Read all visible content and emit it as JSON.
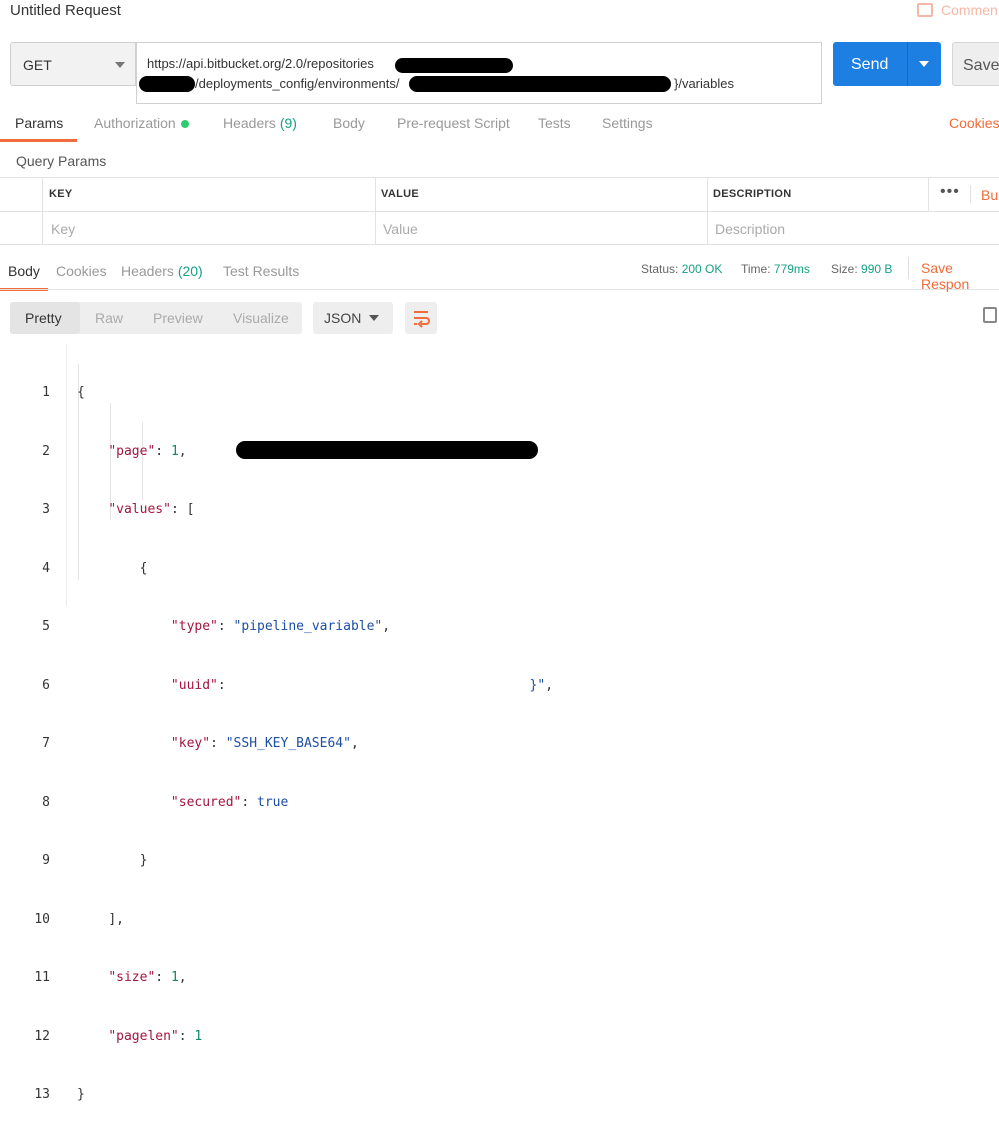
{
  "window": {
    "title": "Untitled Request",
    "comments_label": "Commen"
  },
  "request": {
    "method": "GET",
    "url_line1": "https://api.bitbucket.org/2.0/repositories",
    "url_line2_a": "/deployments_config/environments/",
    "url_line2_b": "}/variables",
    "send_label": "Send",
    "save_label": "Save"
  },
  "request_tabs": {
    "params": "Params",
    "authorization": "Authorization",
    "headers": "Headers",
    "headers_count": "(9)",
    "body": "Body",
    "prerequest": "Pre-request Script",
    "tests": "Tests",
    "settings": "Settings",
    "cookies": "Cookies"
  },
  "query_params": {
    "title": "Query Params",
    "columns": [
      "KEY",
      "VALUE",
      "DESCRIPTION"
    ],
    "placeholders": [
      "Key",
      "Value",
      "Description"
    ],
    "more": "•••",
    "bulk": "Bul"
  },
  "response_tabs": {
    "body": "Body",
    "cookies": "Cookies",
    "headers": "Headers",
    "headers_count": "(20)",
    "test_results": "Test Results"
  },
  "response_meta": {
    "status_label": "Status:",
    "status_value": "200 OK",
    "time_label": "Time:",
    "time_value": "779ms",
    "size_label": "Size:",
    "size_value": "990 B",
    "save_response": "Save Respon"
  },
  "view_modes": [
    "Pretty",
    "Raw",
    "Preview",
    "Visualize"
  ],
  "format": "JSON",
  "code": {
    "line_numbers": [
      "1",
      "2",
      "3",
      "4",
      "5",
      "6",
      "7",
      "8",
      "9",
      "10",
      "11",
      "12",
      "13"
    ],
    "page_key": "\"page\"",
    "page_val": "1",
    "values_key": "\"values\"",
    "type_key": "\"type\"",
    "type_val": "\"pipeline_variable\"",
    "uuid_key": "\"uuid\"",
    "uuid_tail": "}\"",
    "key_key": "\"key\"",
    "key_val": "\"SSH_KEY_BASE64\"",
    "secured_key": "\"secured\"",
    "secured_val": "true",
    "size_key": "\"size\"",
    "size_val": "1",
    "pagelen_key": "\"pagelen\"",
    "pagelen_val": "1"
  },
  "colors": {
    "accent": "#f26b3a",
    "send": "#1e7fe3",
    "ok": "#16a085"
  }
}
